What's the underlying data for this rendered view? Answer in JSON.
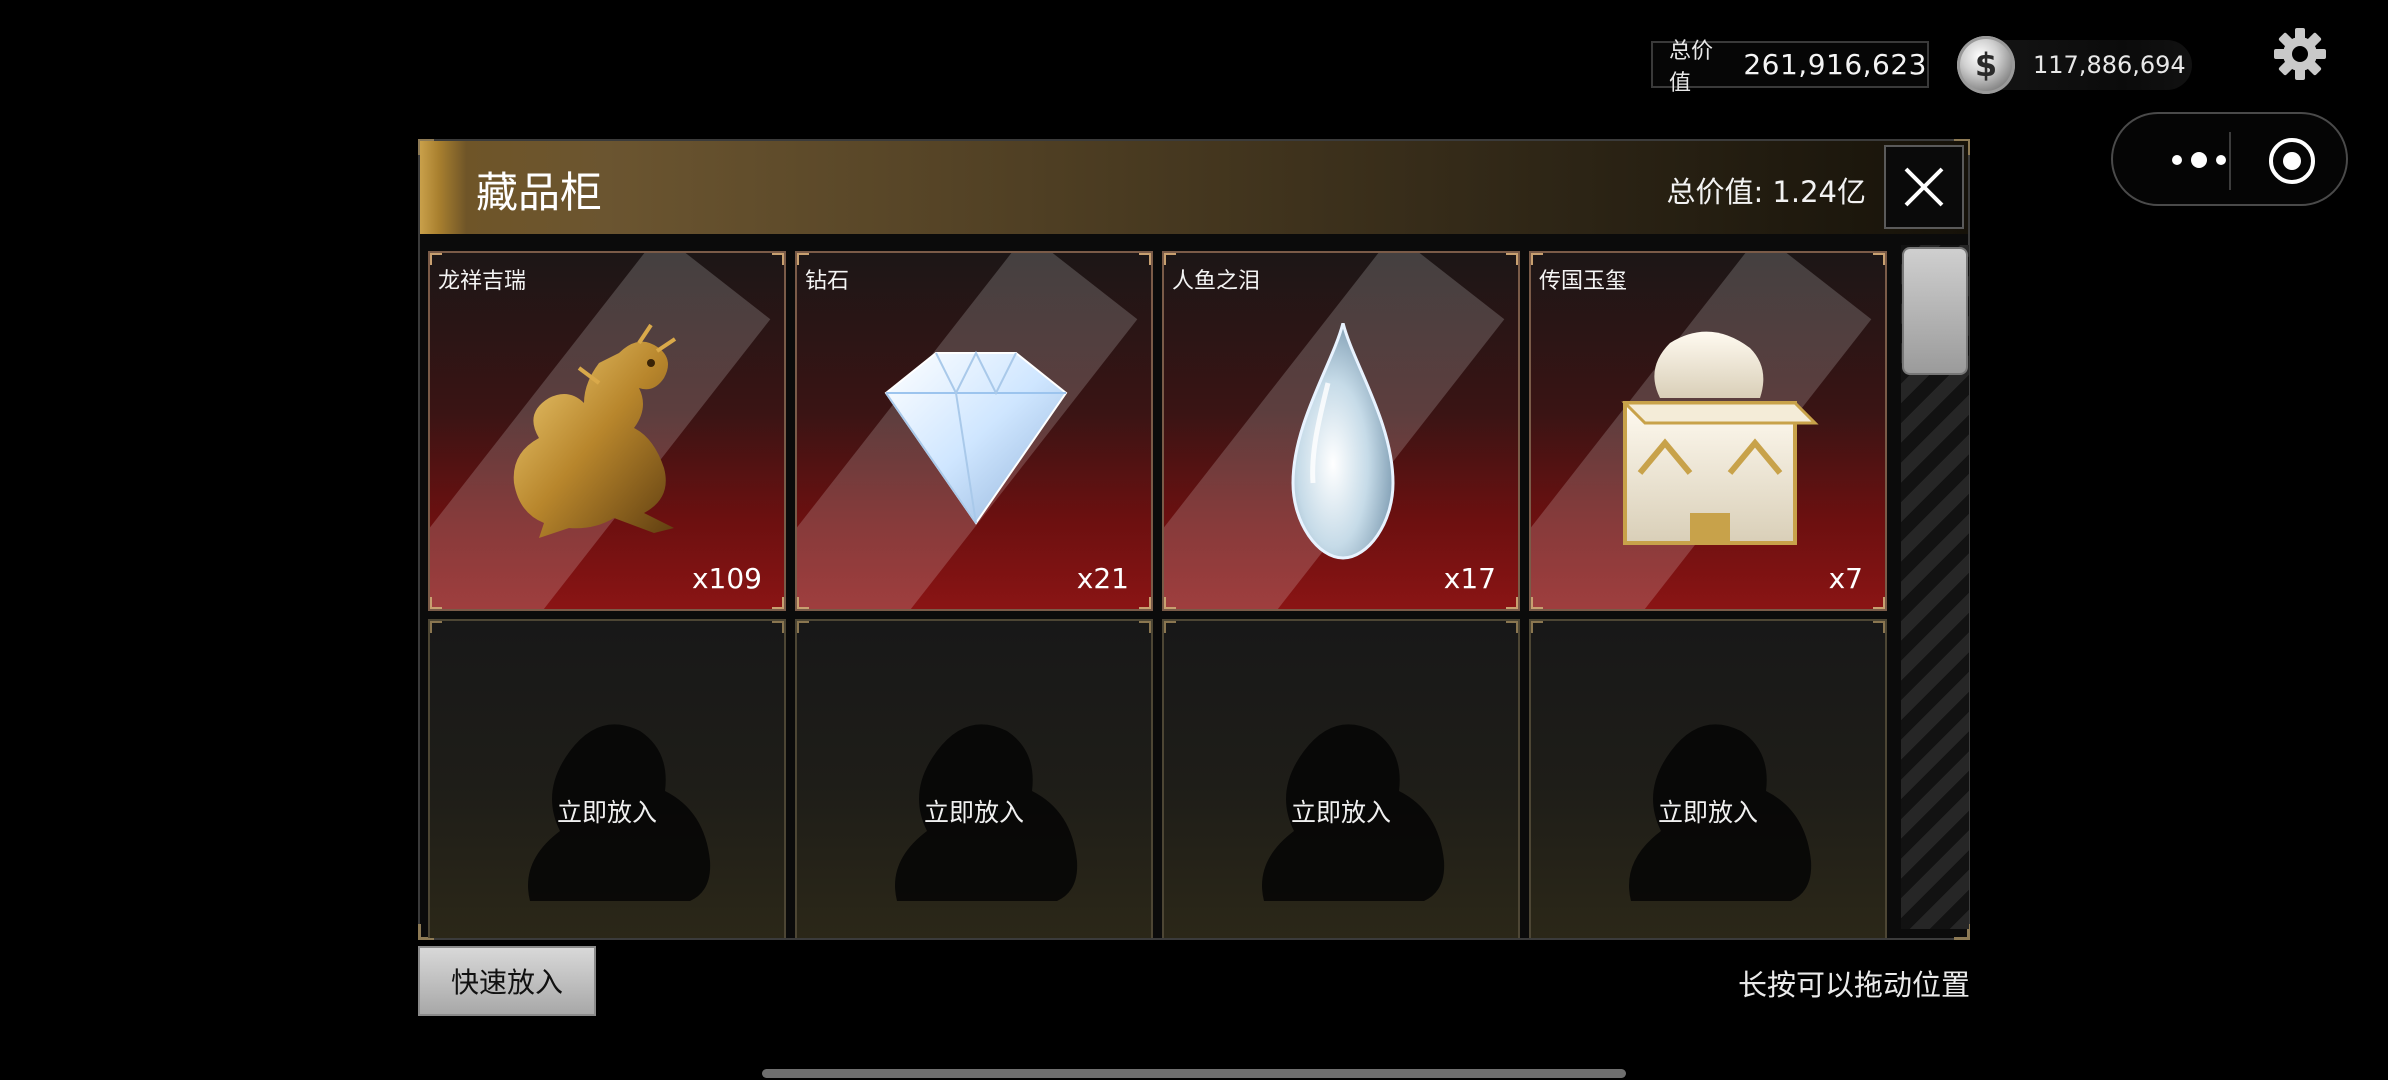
{
  "status_bar": {
    "total_label": "总价值",
    "total_value": "261,916,623",
    "coin_value": "117,886,694",
    "coin_symbol": "$",
    "settings_icon": "gear-icon"
  },
  "mini_program_capsule": {
    "more_icon": "more-dots-icon",
    "close_icon": "target-circle-icon"
  },
  "cabinet": {
    "title": "藏品柜",
    "total_value_text": "总价值: 1.24亿",
    "close_icon": "close-icon",
    "items": [
      {
        "name": "龙祥吉瑞",
        "quantity": "x109",
        "icon": "golden-dragon-icon"
      },
      {
        "name": "钻石",
        "quantity": "x21",
        "icon": "diamond-icon"
      },
      {
        "name": "人鱼之泪",
        "quantity": "x17",
        "icon": "teardrop-icon"
      },
      {
        "name": "传国玉玺",
        "quantity": "x7",
        "icon": "jade-seal-icon"
      }
    ],
    "empty_slots": [
      {
        "label": "立即放入",
        "icon": "lion-silhouette-icon"
      },
      {
        "label": "立即放入",
        "icon": "lion-silhouette-icon"
      },
      {
        "label": "立即放入",
        "icon": "lion-silhouette-icon"
      },
      {
        "label": "立即放入",
        "icon": "lion-silhouette-icon"
      }
    ]
  },
  "footer": {
    "quick_place_label": "快速放入",
    "hint": "长按可以拖动位置"
  },
  "colors": {
    "header_gold": "#c9a04a",
    "card_red": "#8a1414",
    "background": "#000000"
  }
}
